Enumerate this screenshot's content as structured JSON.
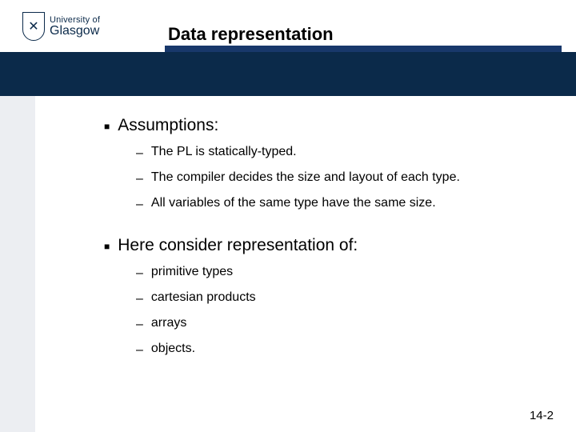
{
  "logo": {
    "line1": "University of",
    "line2": "Glasgow"
  },
  "title": "Data representation",
  "bullets": [
    {
      "text": "Assumptions:",
      "sub": [
        "The PL is statically-typed.",
        "The compiler decides the size and layout of each type.",
        "All variables of the same type have the same size."
      ]
    },
    {
      "text": "Here consider representation of:",
      "sub": [
        "primitive types",
        "cartesian products",
        "arrays",
        "objects."
      ]
    }
  ],
  "page_number": "14-2"
}
